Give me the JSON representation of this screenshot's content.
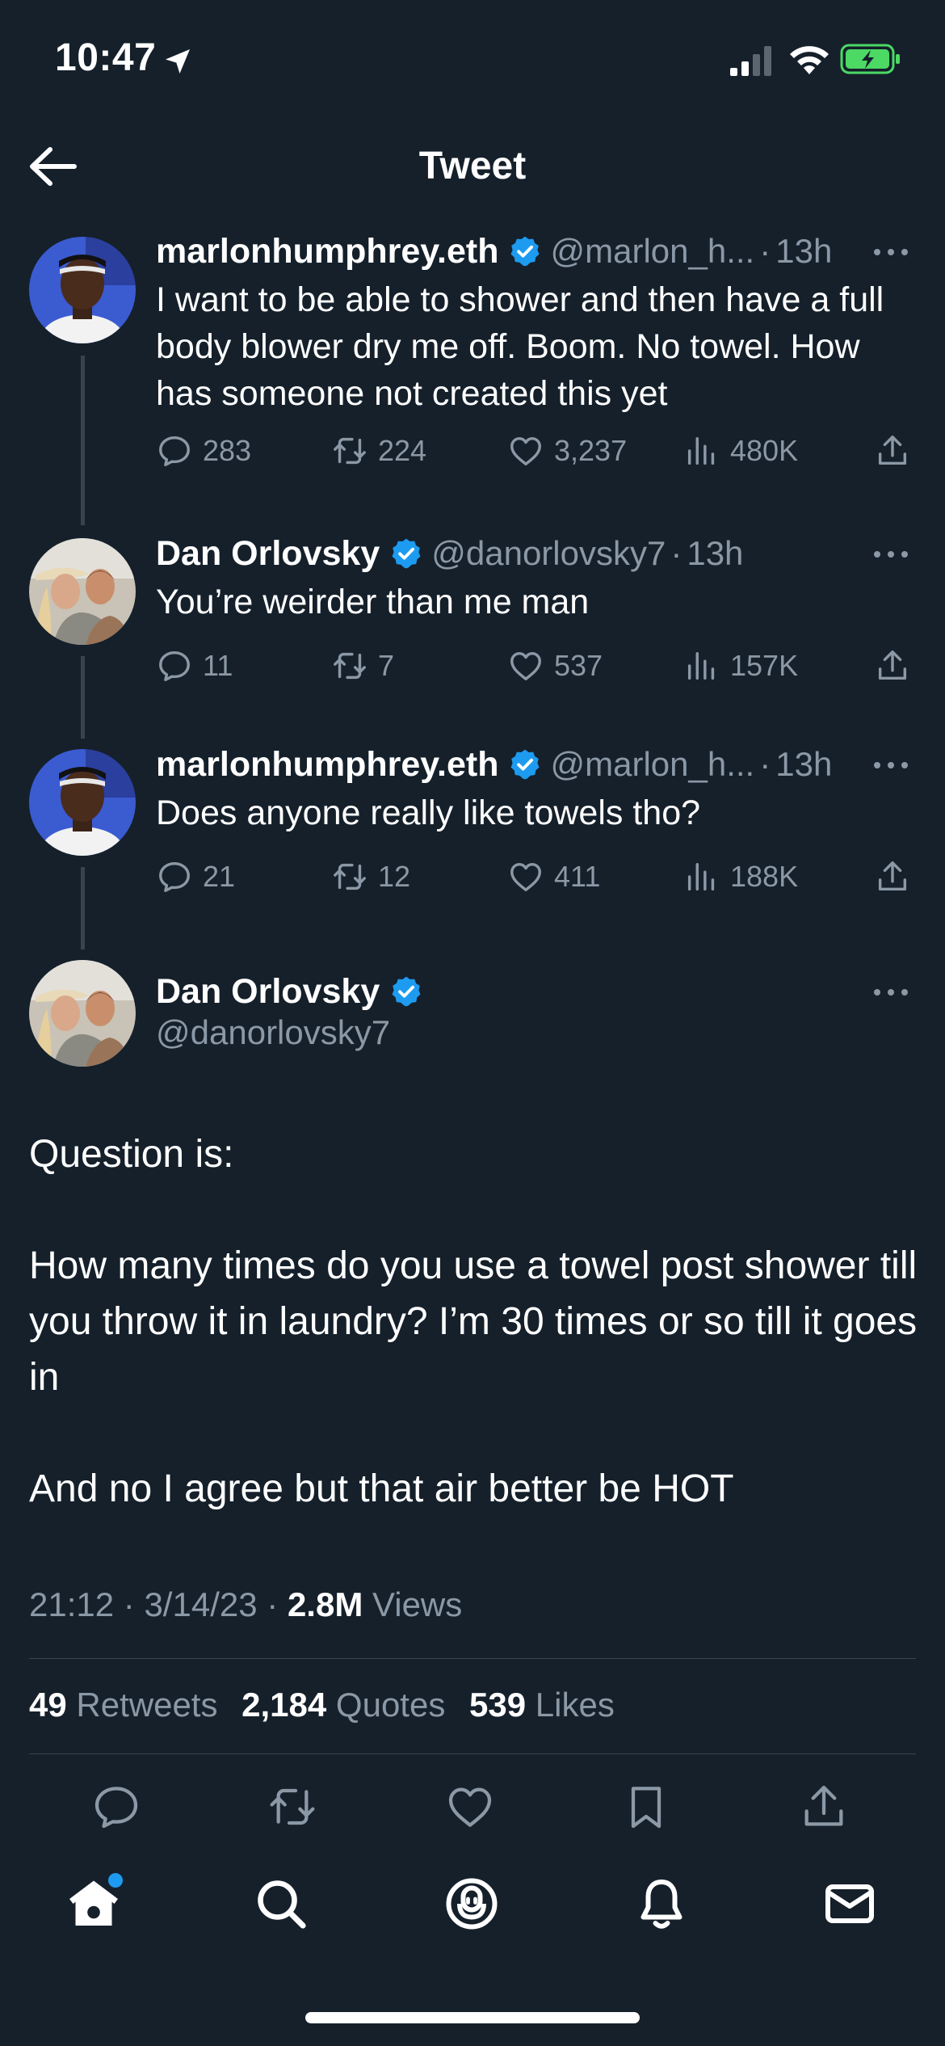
{
  "status_bar": {
    "time": "10:47"
  },
  "header": {
    "title": "Tweet"
  },
  "thread": [
    {
      "name": "marlonhumphrey.eth",
      "handle": "@marlon_h...",
      "time": "13h",
      "text": "I want to be able to shower and then have a full body blower dry me off. Boom. No towel. How has someone not created this yet",
      "replies": "283",
      "retweets": "224",
      "likes": "3,237",
      "views": "480K"
    },
    {
      "name": "Dan Orlovsky",
      "handle": "@danorlovsky7",
      "time": "13h",
      "text": "You’re weirder than me man",
      "replies": "11",
      "retweets": "7",
      "likes": "537",
      "views": "157K"
    },
    {
      "name": "marlonhumphrey.eth",
      "handle": "@marlon_h...",
      "time": "13h",
      "text": "Does anyone really like towels tho?",
      "replies": "21",
      "retweets": "12",
      "likes": "411",
      "views": "188K"
    }
  ],
  "main_tweet": {
    "name": "Dan Orlovsky",
    "handle": "@danorlovsky7",
    "text": "Question is:\n\nHow many times do you use a towel post shower till you throw it in laundry? I’m 30 times or so till it goes in\n\nAnd no I agree but that air better be HOT",
    "time": "21:12",
    "date": "3/14/23",
    "views_count": "2.8M",
    "views_label": "Views",
    "retweets_count": "49",
    "retweets_label": "Retweets",
    "quotes_count": "2,184",
    "quotes_label": "Quotes",
    "likes_count": "539",
    "likes_label": "Likes"
  },
  "separator": "·",
  "colors": {
    "background": "#15202b",
    "text_secondary": "#8b98a5",
    "verified": "#1d9bf0",
    "battery": "#4cd964",
    "divider": "#38444d"
  },
  "icons": [
    "back-arrow-icon",
    "location-arrow-icon",
    "signal-icon",
    "wifi-icon",
    "battery-icon",
    "verified-icon",
    "more-icon",
    "reply-icon",
    "retweet-icon",
    "like-icon",
    "views-icon",
    "share-icon",
    "bookmark-icon",
    "home-icon",
    "search-icon",
    "spaces-icon",
    "notifications-icon",
    "messages-icon"
  ]
}
